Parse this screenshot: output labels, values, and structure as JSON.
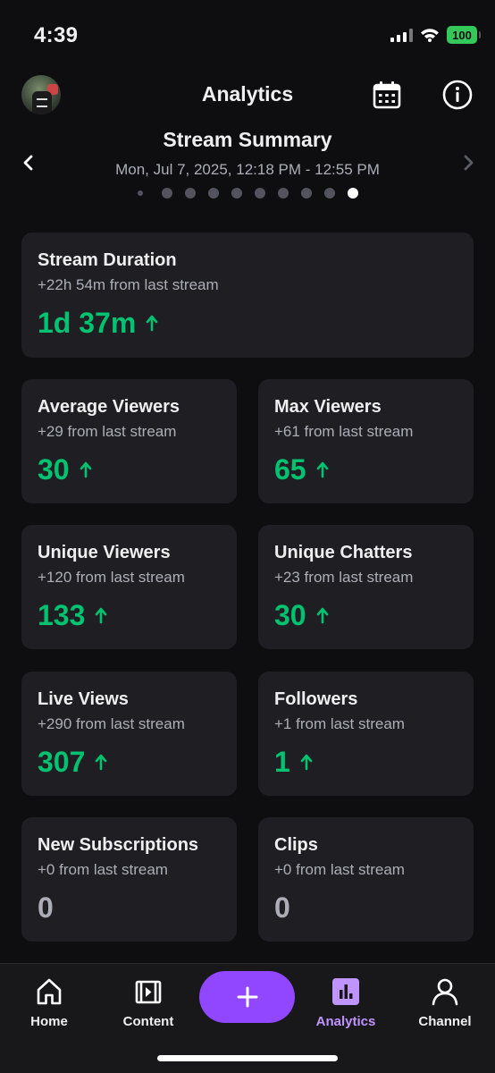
{
  "status_bar": {
    "time": "4:39",
    "battery": "100"
  },
  "header": {
    "title": "Analytics"
  },
  "summary": {
    "title": "Stream Summary",
    "date_range": "Mon, Jul 7, 2025, 12:18 PM - 12:55 PM",
    "page_count": 10,
    "active_page": 10
  },
  "cards": {
    "duration": {
      "title": "Stream Duration",
      "delta": "+22h 54m from last stream",
      "value": "1d 37m",
      "trend": "up"
    },
    "avg_viewers": {
      "title": "Average Viewers",
      "delta": "+29 from last stream",
      "value": "30",
      "trend": "up"
    },
    "max_viewers": {
      "title": "Max Viewers",
      "delta": "+61 from last stream",
      "value": "65",
      "trend": "up"
    },
    "unique_viewers": {
      "title": "Unique Viewers",
      "delta": "+120 from last stream",
      "value": "133",
      "trend": "up"
    },
    "unique_chatters": {
      "title": "Unique Chatters",
      "delta": "+23 from last stream",
      "value": "30",
      "trend": "up"
    },
    "live_views": {
      "title": "Live Views",
      "delta": "+290 from last stream",
      "value": "307",
      "trend": "up"
    },
    "followers": {
      "title": "Followers",
      "delta": "+1 from last stream",
      "value": "1",
      "trend": "up"
    },
    "new_subs": {
      "title": "New Subscriptions",
      "delta": "+0 from last stream",
      "value": "0",
      "trend": "none"
    },
    "clips": {
      "title": "Clips",
      "delta": "+0 from last stream",
      "value": "0",
      "trend": "none"
    }
  },
  "tabbar": {
    "home": "Home",
    "content": "Content",
    "analytics": "Analytics",
    "channel": "Channel"
  },
  "colors": {
    "background": "#0e0e10",
    "card": "#1f1f23",
    "positive": "#00c271",
    "accent": "#9147ff",
    "accent_light": "#bf94ff"
  },
  "icons": {
    "header": [
      "calendar-icon",
      "info-icon"
    ],
    "tabs": [
      "home-icon",
      "content-icon",
      "plus-icon",
      "analytics-icon",
      "channel-icon"
    ]
  }
}
